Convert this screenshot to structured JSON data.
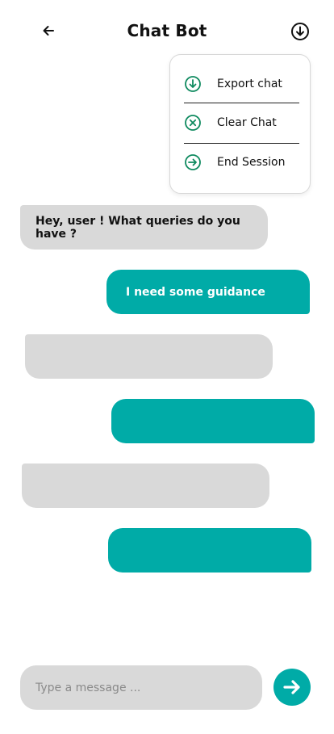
{
  "header": {
    "title": "Chat Bot",
    "back_icon": "arrow-left-icon",
    "menu_icon": "circle-arrow-down-icon"
  },
  "menu": {
    "items": [
      {
        "label": "Export chat",
        "icon": "circle-arrow-down-icon"
      },
      {
        "label": "Clear Chat",
        "icon": "circle-x-icon"
      },
      {
        "label": "End Session",
        "icon": "circle-arrow-right-icon"
      }
    ]
  },
  "messages": [
    {
      "sender": "bot",
      "text": "Hey, user ! What queries do you have ?"
    },
    {
      "sender": "user",
      "text": "I need some guidance"
    },
    {
      "sender": "bot",
      "text": ""
    },
    {
      "sender": "user",
      "text": ""
    },
    {
      "sender": "bot",
      "text": ""
    },
    {
      "sender": "user",
      "text": ""
    }
  ],
  "composer": {
    "placeholder": "Type a message ...",
    "value": "",
    "send_icon": "circle-arrow-right-icon"
  },
  "colors": {
    "accent": "#00aba7",
    "bot_bubble": "#d9d9d9",
    "menu_icon": "#0f8a5f"
  }
}
